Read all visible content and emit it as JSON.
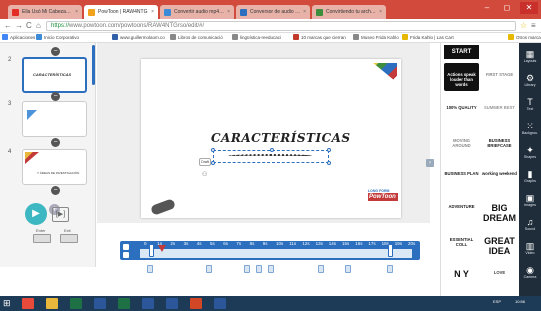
{
  "browser": {
    "tabs": [
      {
        "label": "Ella Usó Mi Cabeza Como",
        "icon": "youtube-icon",
        "color": "#e52d27"
      },
      {
        "label": "PowToon | RAW4NTG",
        "icon": "powtoon-icon",
        "color": "#f2a31b",
        "active": true
      },
      {
        "label": "Convertir audio mp4 a mp3",
        "icon": "g-icon",
        "color": "#3b8bd8"
      },
      {
        "label": "Conversor de audio onlin",
        "icon": "globe-icon",
        "color": "#2c6fbf"
      },
      {
        "label": "Convirtiendo tu archivo",
        "icon": "convert-icon",
        "color": "#3d8f3d"
      }
    ],
    "window_controls": {
      "minimize": "–",
      "maximize": "◻",
      "close": "✕"
    },
    "nav": {
      "back": "←",
      "forward": "→",
      "reload": "C",
      "home": "⌂"
    },
    "url_secure": "https://",
    "url_rest": "www.powtoon.com/powtoons/RAW4NTGrso/edit/#/",
    "bookmarks": [
      {
        "label": "Aplicaciones",
        "color": "#4285f4"
      },
      {
        "label": "Inicio Corporativo",
        "color": "#3b8bd8"
      },
      {
        "label": "www.guillermolaom.co",
        "color": "#2f5fa8"
      },
      {
        "label": "Libros de comunicació",
        "color": "#888888"
      },
      {
        "label": "lingüística-reeducaci",
        "color": "#888888"
      },
      {
        "label": "10 marcas que cierran",
        "color": "#c0392b"
      },
      {
        "label": "Museo Frida Kahlo",
        "color": "#888888"
      },
      {
        "label": "Frida Kahlo | Las Cart",
        "color": "#e6b800"
      },
      {
        "label": "Otros marcado",
        "color": "#e6b800"
      }
    ]
  },
  "slides_panel": {
    "slides": [
      {
        "num": "2",
        "title": "CARACTERÍSTICAS",
        "selected": true
      },
      {
        "num": "3",
        "title": "",
        "selected": false
      },
      {
        "num": "4",
        "title": "Y ÁREAS DE INVESTIGACIÓN",
        "selected": false
      }
    ],
    "add_button": "+",
    "remove_button": "−"
  },
  "playback": {
    "play": "▶",
    "play_from": "[▶]",
    "enter_label": "Enter",
    "exit_label": "Exit"
  },
  "slide": {
    "title": "CARACTERÍSTICAS",
    "chip_label": "Draft",
    "logo_top": "LONG FORM",
    "logo_main": "PowToon"
  },
  "timeline": {
    "ticks": [
      "0",
      "1s",
      "2s",
      "3s",
      "4s",
      "5s",
      "6s",
      "7s",
      "8s",
      "9s",
      "10s",
      "11s",
      "12s",
      "13s",
      "14s",
      "15s",
      "16s",
      "17s",
      "18s",
      "19s",
      "20s"
    ],
    "playhead": 1.4
  },
  "library": {
    "header": "START",
    "tiles": [
      {
        "label": "Actions speak louder than words",
        "bg": "#111111",
        "fg": "#ffffff"
      },
      {
        "label": "FIRST STAGE",
        "bg": "#ffffff",
        "fg": "#888888"
      },
      {
        "label": "100% QUALITY",
        "bg": "#ffffff",
        "fg": "#222222"
      },
      {
        "label": "SUMMER BEST",
        "bg": "#ffffff",
        "fg": "#999999"
      },
      {
        "label": "MOVING AROUND",
        "bg": "#ffffff",
        "fg": "#888888"
      },
      {
        "label": "BUSINESS BRIEFCASE",
        "bg": "#ffffff",
        "fg": "#222222"
      },
      {
        "label": "BUSINESS PLAN",
        "bg": "#ffffff",
        "fg": "#222222"
      },
      {
        "label": "working weekend",
        "bg": "#ffffff",
        "fg": "#222222"
      },
      {
        "label": "ADVENTURE",
        "bg": "#ffffff",
        "fg": "#222222"
      },
      {
        "label": "BIG DREAM",
        "bg": "#ffffff",
        "fg": "#111111"
      },
      {
        "label": "ESSENTIAL COLL",
        "bg": "#ffffff",
        "fg": "#222222"
      },
      {
        "label": "GREAT IDEA",
        "bg": "#ffffff",
        "fg": "#111111"
      },
      {
        "label": "N Y",
        "bg": "#ffffff",
        "fg": "#111111"
      },
      {
        "label": "LOVE",
        "bg": "#ffffff",
        "fg": "#444444"
      }
    ]
  },
  "side_menu": [
    {
      "label": "Layouts",
      "icon": "▦"
    },
    {
      "label": "Library",
      "icon": "⚙"
    },
    {
      "label": "Text",
      "icon": "T"
    },
    {
      "label": "Backgrou.",
      "icon": "⁙"
    },
    {
      "label": "Shapes",
      "icon": "✦"
    },
    {
      "label": "Graphs",
      "icon": "▮"
    },
    {
      "label": "Images",
      "icon": "▣"
    },
    {
      "label": "Sound",
      "icon": "♫"
    },
    {
      "label": "Video",
      "icon": "▥"
    },
    {
      "label": "Camera",
      "icon": "◉"
    }
  ],
  "taskbar": {
    "apps": [
      {
        "icon": "chrome-icon",
        "color": "#e84a3b"
      },
      {
        "icon": "explorer-icon",
        "color": "#e8b73b"
      },
      {
        "icon": "excel-icon",
        "color": "#1e7145"
      },
      {
        "icon": "word-icon",
        "color": "#2b579a"
      },
      {
        "icon": "excel-icon",
        "color": "#1e7145"
      },
      {
        "icon": "word-icon",
        "color": "#2b579a"
      },
      {
        "icon": "word-icon",
        "color": "#2b579a"
      },
      {
        "icon": "powerpoint-icon",
        "color": "#d24726"
      },
      {
        "icon": "word-icon",
        "color": "#2b579a"
      }
    ],
    "lang": "ESP",
    "time": "10:56"
  }
}
